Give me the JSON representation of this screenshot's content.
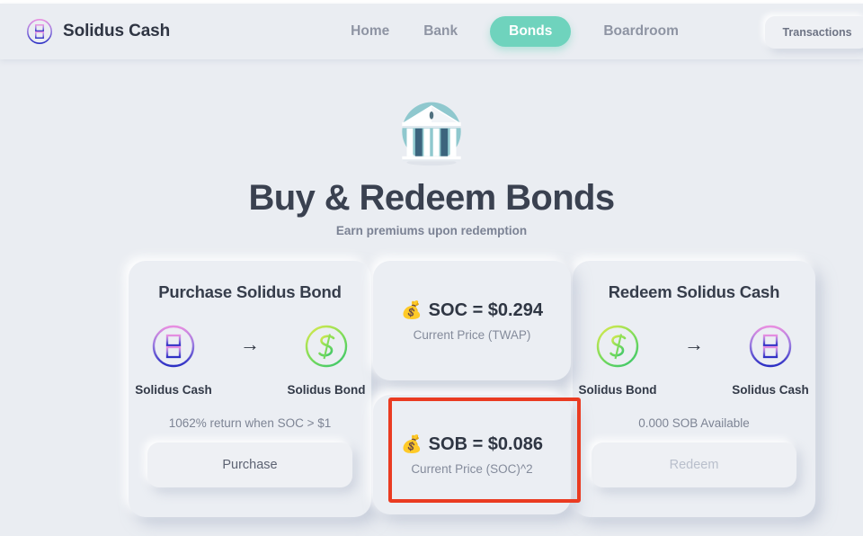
{
  "brand": {
    "name": "Solidus Cash",
    "logo_icon": "solidus-cash-token-icon"
  },
  "nav": {
    "items": [
      {
        "label": "Home",
        "active": false
      },
      {
        "label": "Bank",
        "active": false
      },
      {
        "label": "Bonds",
        "active": true
      },
      {
        "label": "Boardroom",
        "active": false
      }
    ],
    "transactions_label": "Transactions",
    "active_pill_color": "#6fd3bd"
  },
  "hero": {
    "icon": "bank-building-icon",
    "title": "Buy & Redeem Bonds",
    "subtitle": "Earn premiums upon redemption"
  },
  "purchase_card": {
    "title": "Purchase Solidus Bond",
    "from_token": {
      "label": "Solidus Cash",
      "icon": "solidus-cash-token-icon"
    },
    "to_token": {
      "label": "Solidus Bond",
      "icon": "solidus-bond-token-icon"
    },
    "arrow": "→",
    "note": "1062% return when SOC > $1",
    "button_label": "Purchase",
    "button_disabled": false
  },
  "price_cards": [
    {
      "emoji": "💰",
      "value_text": "SOC = $0.294",
      "symbol": "SOC",
      "price": 0.294,
      "subtitle": "Current Price (TWAP)",
      "highlighted": false
    },
    {
      "emoji": "💰",
      "value_text": "SOB = $0.086",
      "symbol": "SOB",
      "price": 0.086,
      "subtitle": "Current Price (SOC)^2",
      "highlighted": true
    }
  ],
  "redeem_card": {
    "title": "Redeem Solidus Cash",
    "from_token": {
      "label": "Solidus Bond",
      "icon": "solidus-bond-token-icon"
    },
    "to_token": {
      "label": "Solidus Cash",
      "icon": "solidus-cash-token-icon"
    },
    "arrow": "→",
    "note": "0.000 SOB Available",
    "button_label": "Redeem",
    "button_disabled": true
  },
  "annotation": {
    "highlight_color": "#ea3b21",
    "target": "sob-price-card"
  }
}
